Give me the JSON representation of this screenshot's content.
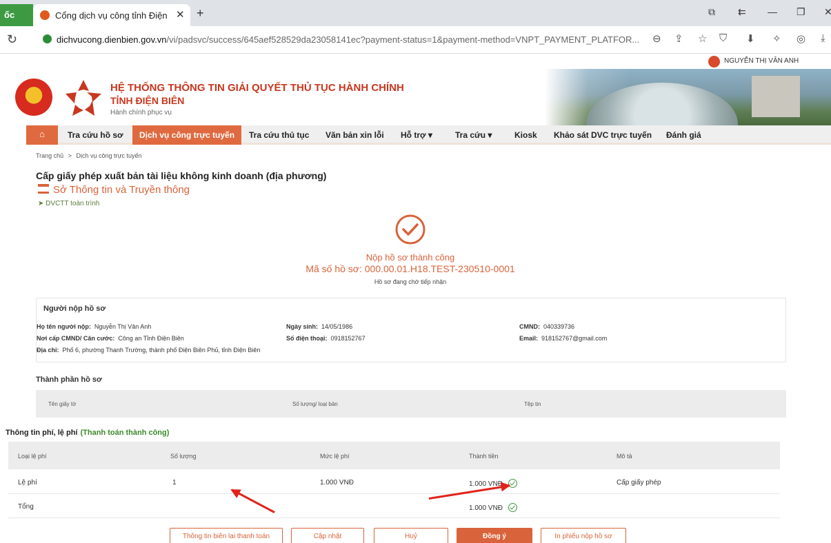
{
  "browser": {
    "side_tab": "ốc",
    "tab_title": "Cổng dịch vụ công tỉnh Điện",
    "url_host": "dichvucong.dienbien.gov.vn",
    "url_path": "/vi/padsvc/success/645aef528529da23058141ec?payment-status=1&payment-method=VNPT_PAYMENT_PLATFOR..."
  },
  "user": {
    "name": "NGUYỄN THỊ VÂN ANH"
  },
  "site": {
    "title": "HỆ THỐNG THÔNG TIN GIẢI QUYẾT THỦ TỤC HÀNH CHÍNH",
    "province": "TỈNH ĐIỆN BIÊN",
    "motto": "Hành chính phục vụ"
  },
  "nav": {
    "home_icon": "home-icon",
    "items": [
      "Tra cứu hồ sơ",
      "Dịch vụ công trực tuyến",
      "Tra cứu thủ tục",
      "Văn bản xin lỗi",
      "Hỗ trợ ▾",
      "Tra cứu ▾",
      "Kiosk",
      "Khảo sát DVC trực tuyến",
      "Đánh giá"
    ]
  },
  "breadcrumb": {
    "home": "Trang chủ",
    "sep": ">",
    "current": "Dịch vụ công trực tuyến"
  },
  "procedure": {
    "title": "Cấp giấy phép xuất bản tài liệu không kinh doanh (địa phương)",
    "agency": "Sở Thông tin và Truyền thông",
    "level": "DVCTT toàn trình"
  },
  "result": {
    "message": "Nộp hồ sơ thành công",
    "code_label": "Mã số hồ sơ: 000.00.01.H18.TEST-230510-0001",
    "status": "Hồ sơ đang chờ tiếp nhận"
  },
  "applicant": {
    "section_title": "Người nộp hồ sơ",
    "name_label": "Họ tên người nộp:",
    "name_value": "Nguyễn Thị Vân Anh",
    "dob_label": "Ngày sinh:",
    "dob_value": "14/05/1986",
    "id_label": "CMND:",
    "id_value": "040339736",
    "issuer_label": "Nơi cấp CMND/ Căn cước:",
    "issuer_value": "Công an Tỉnh Điện Biên",
    "phone_label": "Số điện thoại:",
    "phone_value": "0918152767",
    "email_label": "Email:",
    "email_value": "918152767@gmail.com",
    "address_label": "Địa chỉ:",
    "address_value": "Phố 6, phường Thanh Trường, thành phố Điện Biên Phủ, tỉnh Điện Biên"
  },
  "documents": {
    "section_title": "Thành phần hồ sơ",
    "columns": [
      "Tên giấy tờ",
      "Số lượng/ loại bản",
      "Tệp tin"
    ]
  },
  "fees": {
    "section_title": "Thông tin phí, lệ phí",
    "payment_status": "(Thanh toán thành công)",
    "columns": [
      "Loại lệ phí",
      "Số lượng",
      "Mức lệ phí",
      "Thành tiền",
      "Mô tả"
    ],
    "rows": [
      {
        "type": "Lệ phí",
        "qty": "1",
        "rate": "1.000 VNĐ",
        "amount": "1.000 VNĐ",
        "desc": "Cấp giấy phép"
      }
    ],
    "total_label": "Tổng",
    "total_amount": "1.000 VNĐ"
  },
  "buttons": {
    "receipt": "Thông tin biên lai thanh toán",
    "update": "Cập nhật",
    "cancel": "Huỷ",
    "agree": "Đồng ý",
    "print": "In phiếu nộp hồ sơ"
  },
  "colors": {
    "accent": "#d9633a",
    "brand_red": "#c8371f",
    "success_green": "#3a8a2a",
    "annotation_arrow": "#e0241b"
  }
}
